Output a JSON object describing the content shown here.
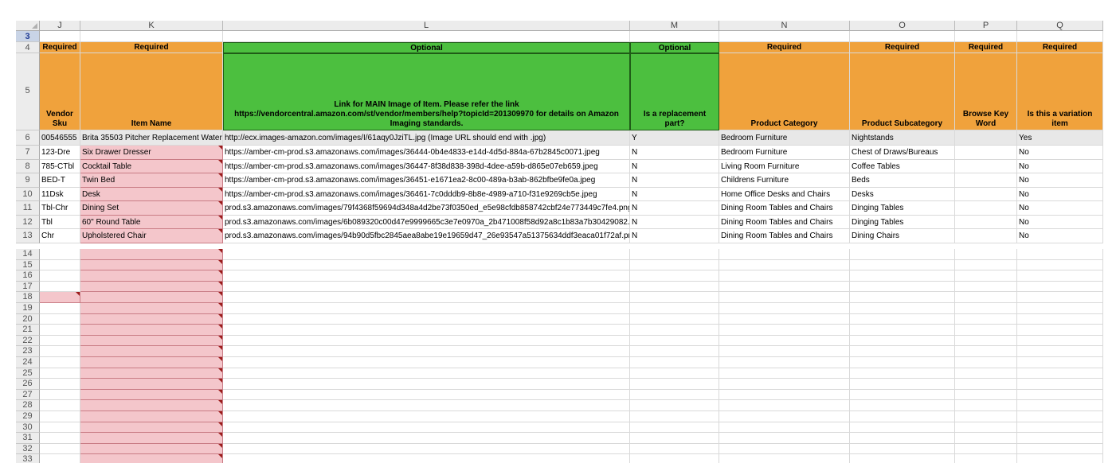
{
  "columns": [
    "J",
    "K",
    "L",
    "M",
    "N",
    "O",
    "P",
    "Q"
  ],
  "row3_label": "3",
  "row_numbers": [
    "4",
    "5",
    "6",
    "7",
    "8",
    "9",
    "10",
    "11",
    "12",
    "13",
    "14",
    "15",
    "16",
    "17",
    "18",
    "19",
    "20",
    "21",
    "22",
    "23",
    "24",
    "25",
    "26",
    "27",
    "28",
    "29",
    "30",
    "31",
    "32",
    "33"
  ],
  "row4": [
    "Required",
    "Required",
    "Optional",
    "Optional",
    "Required",
    "Required",
    "Required",
    "Required"
  ],
  "row5": [
    "Vendor Sku",
    "Item Name",
    "Link for MAIN Image of Item. Please refer the link https://vendorcentral.amazon.com/st/vendor/members/help?topicId=201309970 for details on Amazon Imaging standards.",
    "Is a replacement part?",
    "Product Category",
    "Product Subcategory",
    "Browse Key Word",
    "Is this a variation item"
  ],
  "example_row": [
    "00546555",
    "Brita 35503 Pitcher Replacement Water",
    "http://ecx.images-amazon.com/images/I/61aqy0JziTL.jpg (Image URL should end with .jpg)",
    "Y",
    "Bedroom Furniture",
    "Nightstands",
    "",
    "Yes"
  ],
  "data_rows": [
    [
      "123-Dre",
      "Six Drawer Dresser",
      "https://amber-cm-prod.s3.amazonaws.com/images/36444-0b4e4833-e14d-4d5d-884a-67b2845c0071.jpeg",
      "N",
      "Bedroom Furniture",
      "Chest of Draws/Bureaus",
      "",
      "No"
    ],
    [
      "785-CTbl",
      "Cocktail Table",
      "https://amber-cm-prod.s3.amazonaws.com/images/36447-8f38d838-398d-4dee-a59b-d865e07eb659.jpeg",
      "N",
      "Living Room Furniture",
      "Coffee Tables",
      "",
      "No"
    ],
    [
      "BED-T",
      "Twin Bed",
      "https://amber-cm-prod.s3.amazonaws.com/images/36451-e1671ea2-8c00-489a-b3ab-862bfbe9fe0a.jpeg",
      "N",
      "Childrens Furniture",
      "Beds",
      "",
      "No"
    ],
    [
      "11Dsk",
      "Desk",
      "https://amber-cm-prod.s3.amazonaws.com/images/36461-7c0dddb9-8b8e-4989-a710-f31e9269cb5e.jpeg",
      "N",
      "Home Office Desks and Chairs",
      "Desks",
      "",
      "No"
    ],
    [
      "Tbl-Chr",
      "Dining Set",
      "prod.s3.amazonaws.com/images/79f4368f59694d348a4d2be73f0350ed_e5e98cfdb858742cbf24e773449c7fe4.png",
      "N",
      "Dining Room Tables and Chairs",
      "Dinging Tables",
      "",
      "No"
    ],
    [
      "Tbl",
      "60\" Round Table",
      "prod.s3.amazonaws.com/images/6b089320c00d47e9999665c3e7e0970a_2b471008f58d92a8c1b83a7b30429082.p",
      "N",
      "Dining Room Tables and Chairs",
      "Dinging Tables",
      "",
      "No"
    ],
    [
      "Chr",
      "Upholstered Chair",
      "prod.s3.amazonaws.com/images/94b90d5fbc2845aea8abe19e19659d47_26e93547a51375634ddf3eaca01f72af.pn",
      "N",
      "Dining Room Tables and Chairs",
      "Dining Chairs",
      "",
      "No"
    ]
  ],
  "colors": {
    "required": "#f0a23c",
    "optional": "#4cbf3f",
    "input_pink": "#f4c6cb",
    "header_gray": "#ececec"
  }
}
